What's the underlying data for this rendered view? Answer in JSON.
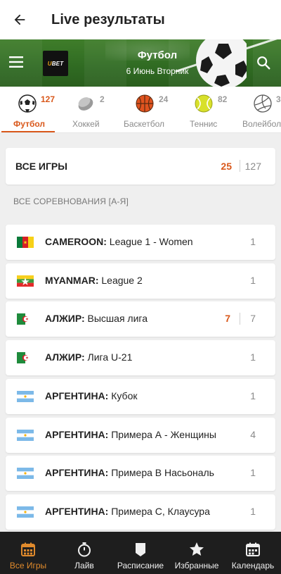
{
  "header": {
    "title": "Live результаты"
  },
  "banner": {
    "sport": "Футбол",
    "date": "6 Июнь Вторник",
    "logo_text": "UBET"
  },
  "sports": [
    {
      "label": "Футбол",
      "count": "127",
      "icon": "soccer-ball-icon",
      "active": true
    },
    {
      "label": "Хоккей",
      "count": "2",
      "icon": "hockey-puck-icon"
    },
    {
      "label": "Баскетбол",
      "count": "24",
      "icon": "basketball-icon"
    },
    {
      "label": "Теннис",
      "count": "82",
      "icon": "tennis-ball-icon"
    },
    {
      "label": "Волейбол",
      "count": "3",
      "icon": "volleyball-icon"
    }
  ],
  "all_games": {
    "label": "ВСЕ ИГРЫ",
    "live": "25",
    "total": "127"
  },
  "section_title": "ВСЕ СОРЕВНОВАНИЯ [А-Я]",
  "competitions": [
    {
      "country": "CAMEROON:",
      "league": " League 1 - Women",
      "count": "1",
      "flag": "cameroon"
    },
    {
      "country": "MYANMAR:",
      "league": " League 2",
      "count": "1",
      "flag": "myanmar"
    },
    {
      "country": "АЛЖИР:",
      "league": " Высшая лига",
      "live": "7",
      "count": "7",
      "flag": "algeria"
    },
    {
      "country": "АЛЖИР:",
      "league": " Лига U-21",
      "count": "1",
      "flag": "algeria"
    },
    {
      "country": "АРГЕНТИНА:",
      "league": " Кубок",
      "count": "1",
      "flag": "argentina"
    },
    {
      "country": "АРГЕНТИНА:",
      "league": " Примера А - Женщины",
      "count": "4",
      "flag": "argentina"
    },
    {
      "country": "АРГЕНТИНА:",
      "league": " Примера В Насьональ",
      "count": "1",
      "flag": "argentina"
    },
    {
      "country": "АРГЕНТИНА:",
      "league": " Примера С, Клаусура",
      "count": "1",
      "flag": "argentina"
    }
  ],
  "bottom_nav": [
    {
      "label": "Все Игры",
      "icon": "calendar-grid-icon",
      "active": true
    },
    {
      "label": "Лайв",
      "icon": "stopwatch-icon"
    },
    {
      "label": "Расписание",
      "icon": "schedule-icon"
    },
    {
      "label": "Избранные",
      "icon": "star-icon"
    },
    {
      "label": "Календарь",
      "icon": "calendar-icon"
    }
  ],
  "colors": {
    "accent": "#d9581b",
    "nav_bg": "#1e1e1e",
    "nav_active": "#e08a2c"
  }
}
